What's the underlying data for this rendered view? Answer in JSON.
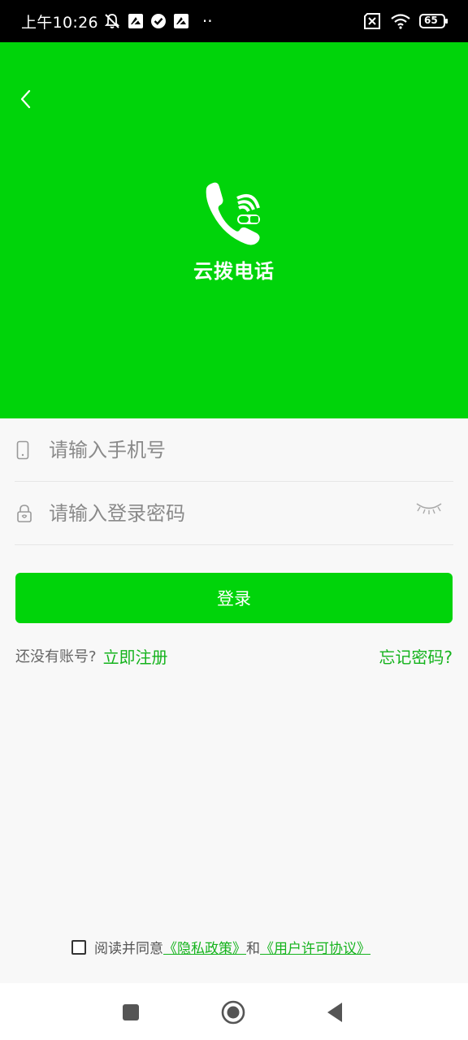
{
  "status_bar": {
    "time": "上午10:26",
    "dots": "··",
    "battery": "65",
    "icons": [
      "mute-bell-icon",
      "app-notification-icon",
      "check-circle-icon",
      "app-notification-icon",
      "sim-off-icon",
      "wifi-icon",
      "battery-icon"
    ]
  },
  "header": {
    "app_name": "云拨电话",
    "logo_icon": "phone-wifi-logo-icon",
    "back_icon": "chevron-left-icon",
    "background_color": "#00d40a"
  },
  "form": {
    "phone_placeholder": "请输入手机号",
    "phone_value": "",
    "phone_icon": "mobile-phone-icon",
    "password_placeholder": "请输入登录密码",
    "password_value": "",
    "password_icon": "lock-icon",
    "eye_icon": "eye-closed-icon"
  },
  "login_button": {
    "label": "登录"
  },
  "links": {
    "no_account": "还没有账号?",
    "register": "立即注册",
    "forgot": "忘记密码?"
  },
  "agreement": {
    "checked": false,
    "prefix": "阅读并同意",
    "privacy": "《隐私政策》",
    "and": "和",
    "license": "《用户许可协议》"
  },
  "nav_bar": {
    "buttons": [
      "recent-apps-icon",
      "home-icon",
      "back-triangle-icon"
    ]
  },
  "colors": {
    "accent": "#00d40a",
    "link": "#15b31d",
    "page_bg": "#f8f8f8"
  }
}
